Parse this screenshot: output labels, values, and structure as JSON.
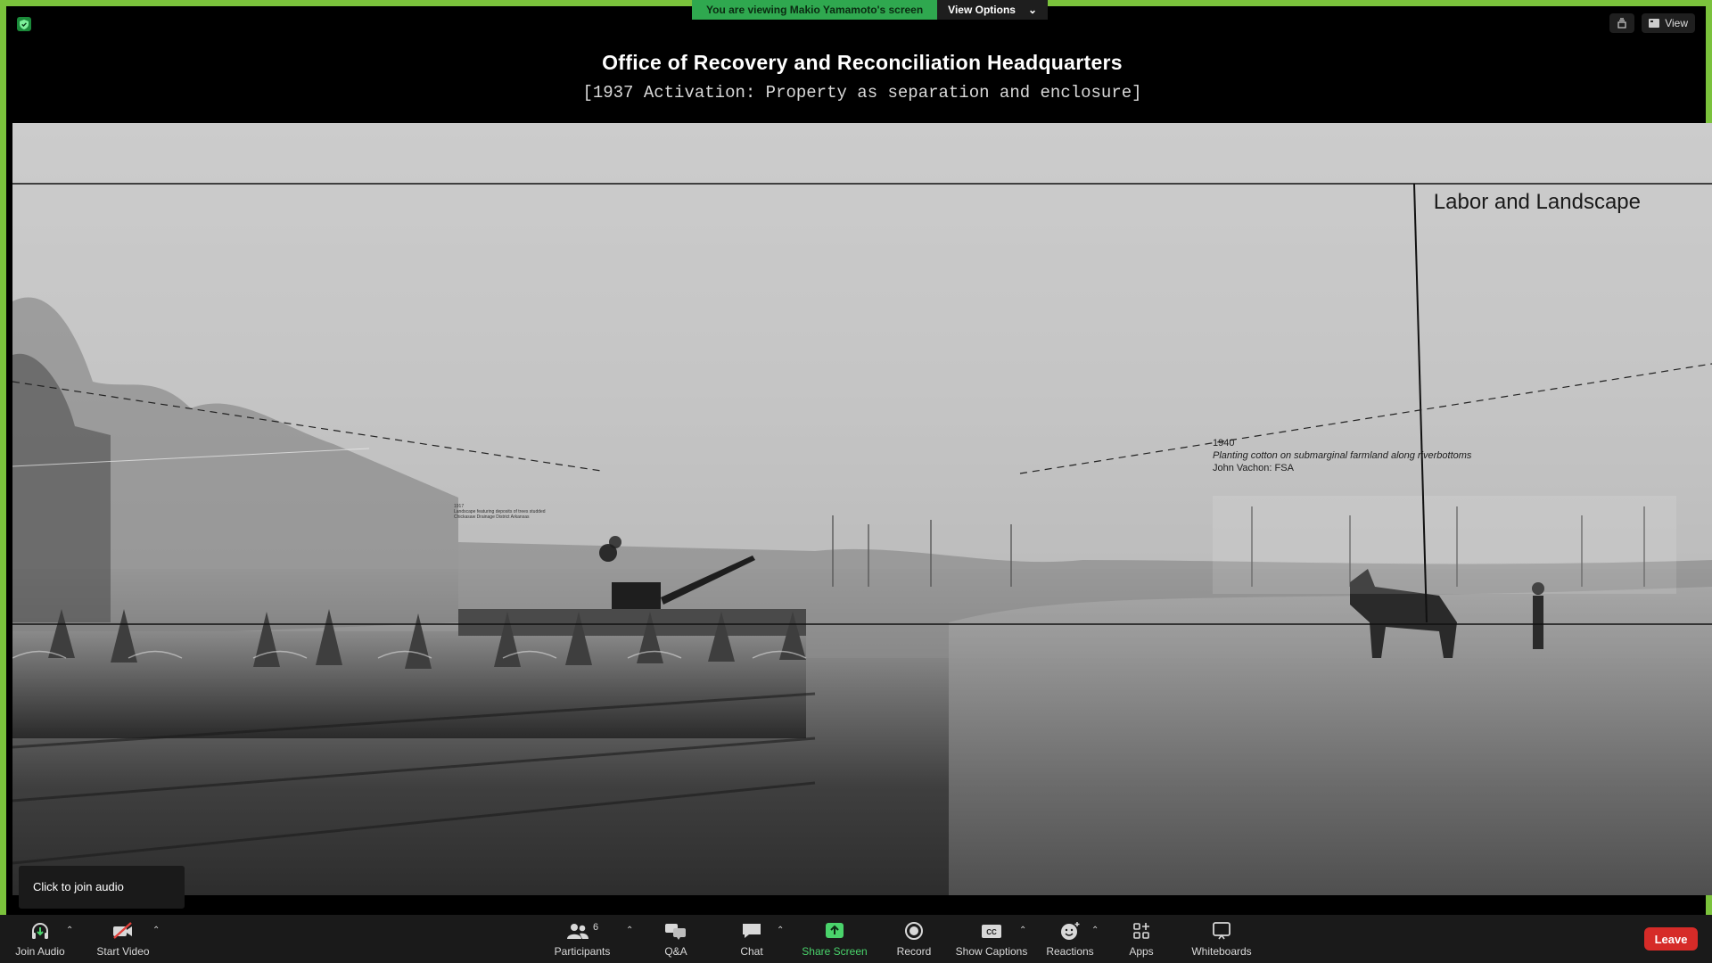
{
  "banner": {
    "viewing_text": "You are viewing Makio Yamamoto's screen",
    "view_options": "View Options"
  },
  "top_right": {
    "view_label": "View"
  },
  "slide": {
    "title": "Office of Recovery and Reconciliation  Headquarters",
    "subtitle": "[1937 Activation: Property as separation and enclosure]",
    "section_label": "Labor and Landscape",
    "caption_year": "1940",
    "caption_desc": "Planting cotton on submarginal farmland along riverbottoms",
    "caption_credit": "John Vachon: FSA",
    "small_caption_year": "1917",
    "small_caption_l1": "Landscape featuring deposits of trees studded",
    "small_caption_l2": "Chickasaw Drainage District Arkansas"
  },
  "join_audio_tip": "Click to join audio",
  "toolbar": {
    "join_audio": "Join Audio",
    "start_video": "Start Video",
    "participants": "Participants",
    "participants_count": "6",
    "qa": "Q&A",
    "chat": "Chat",
    "share_screen": "Share Screen",
    "record": "Record",
    "show_captions": "Show Captions",
    "reactions": "Reactions",
    "apps": "Apps",
    "whiteboards": "Whiteboards",
    "leave": "Leave"
  },
  "colors": {
    "border": "#7bc23c",
    "share_green": "#4ad36b",
    "leave_red": "#d62b28",
    "banner_green": "#2fa84f"
  }
}
